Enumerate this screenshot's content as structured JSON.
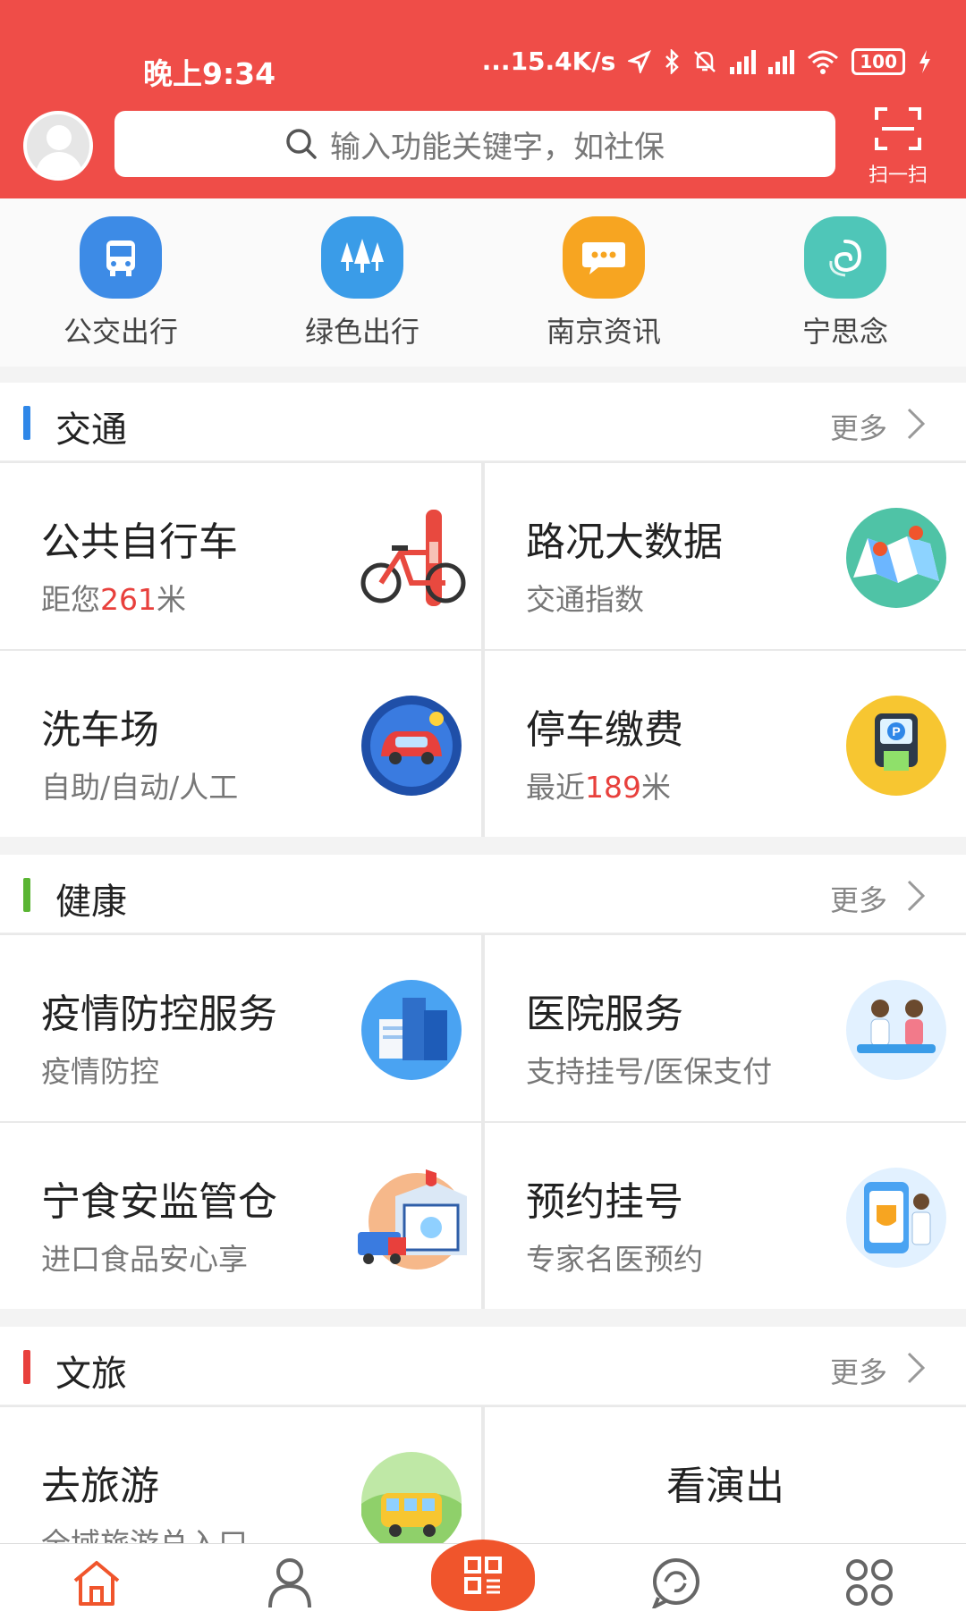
{
  "status_bar": {
    "time": "晚上9:34",
    "net_speed": "...15.4K/s",
    "battery": "100"
  },
  "header": {
    "search_placeholder": "输入功能关键字，如社保",
    "scan_label": "扫一扫"
  },
  "quick_links": [
    {
      "label": "公交出行",
      "icon": "bus-icon",
      "color": "#3d8be6"
    },
    {
      "label": "绿色出行",
      "icon": "tree-icon",
      "color": "#3a9ce8"
    },
    {
      "label": "南京资讯",
      "icon": "chat-bubble-icon",
      "color": "#f7a521"
    },
    {
      "label": "宁思念",
      "icon": "swirl-icon",
      "color": "#4fc6b8"
    }
  ],
  "sections": [
    {
      "title": "交通",
      "more": "更多",
      "bar_color": "#2f87e8",
      "cards": [
        {
          "title": "公共自行车",
          "sub_prefix": "距您",
          "sub_highlight": "261",
          "sub_suffix": "米",
          "icon": "bicycle-icon"
        },
        {
          "title": "路况大数据",
          "sub_prefix": "交通指数",
          "sub_highlight": "",
          "sub_suffix": "",
          "icon": "map-icon"
        },
        {
          "title": "洗车场",
          "sub_prefix": "自助/自动/人工",
          "sub_highlight": "",
          "sub_suffix": "",
          "icon": "car-wash-icon"
        },
        {
          "title": "停车缴费",
          "sub_prefix": "最近",
          "sub_highlight": "189",
          "sub_suffix": "米",
          "icon": "parking-icon"
        }
      ]
    },
    {
      "title": "健康",
      "more": "更多",
      "bar_color": "#5ab533",
      "cards": [
        {
          "title": "疫情防控服务",
          "sub_prefix": "疫情防控",
          "sub_highlight": "",
          "sub_suffix": "",
          "icon": "city-icon"
        },
        {
          "title": "医院服务",
          "sub_prefix": "支持挂号/医保支付",
          "sub_highlight": "",
          "sub_suffix": "",
          "icon": "doctor-icon"
        },
        {
          "title": "宁食安监管仓",
          "sub_prefix": "进口食品安心享",
          "sub_highlight": "",
          "sub_suffix": "",
          "icon": "warehouse-icon"
        },
        {
          "title": "预约挂号",
          "sub_prefix": "专家名医预约",
          "sub_highlight": "",
          "sub_suffix": "",
          "icon": "appointment-icon"
        }
      ]
    },
    {
      "title": "文旅",
      "more": "更多",
      "bar_color": "#e8403c",
      "cards": [
        {
          "title": "去旅游",
          "sub_prefix": "全域旅游总入口",
          "sub_highlight": "",
          "sub_suffix": "",
          "icon": "travel-bus-icon"
        },
        {
          "title": "看演出",
          "sub_prefix": "",
          "sub_highlight": "",
          "sub_suffix": "",
          "icon": ""
        }
      ]
    }
  ],
  "tabbar": [
    {
      "name": "home",
      "icon": "home-icon",
      "color": "#f0552c"
    },
    {
      "name": "profile",
      "icon": "person-icon",
      "color": "#666"
    },
    {
      "name": "qrcode",
      "icon": "qrcode-icon",
      "color": "#fff"
    },
    {
      "name": "messages",
      "icon": "chat-icon",
      "color": "#666"
    },
    {
      "name": "apps",
      "icon": "apps-grid-icon",
      "color": "#666"
    }
  ]
}
